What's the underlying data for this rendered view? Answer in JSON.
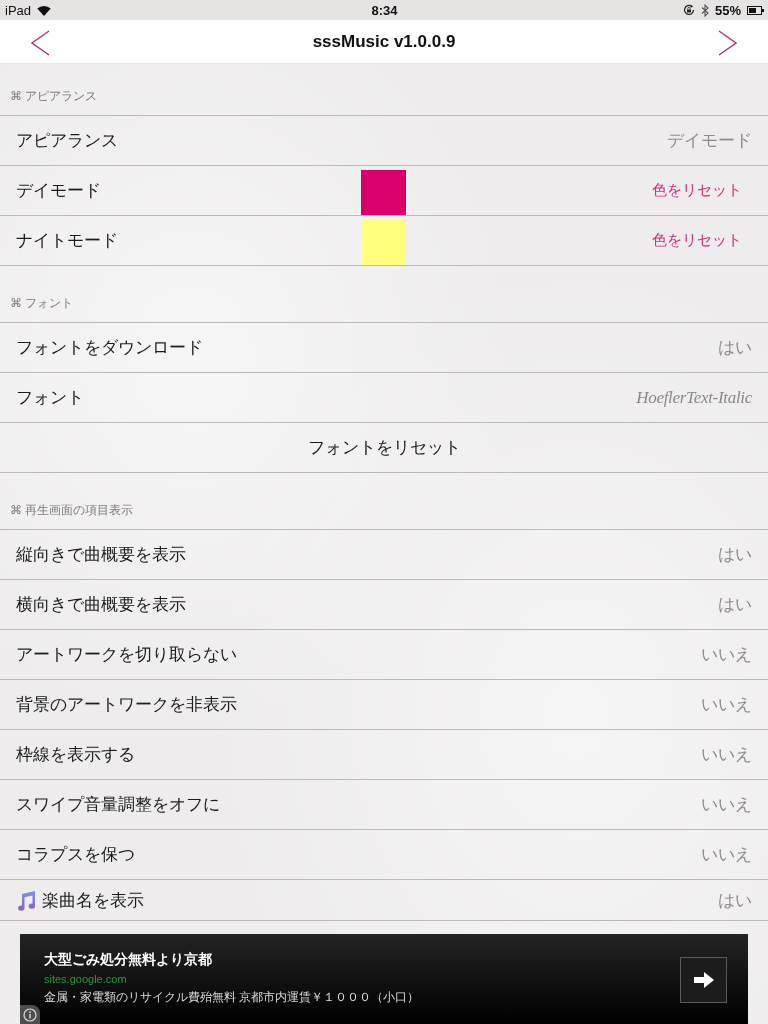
{
  "status_bar": {
    "carrier": "iPad",
    "time": "8:34",
    "battery": "55%"
  },
  "nav_bar": {
    "title": "sssMusic v1.0.0.9"
  },
  "sections": [
    {
      "header": "⌘ アピアランス",
      "rows": [
        {
          "kind": "value",
          "label": "アピアランス",
          "value": "デイモード"
        },
        {
          "kind": "swatch",
          "label": "デイモード",
          "color": "#d9006c",
          "action": "色をリセット"
        },
        {
          "kind": "swatch",
          "label": "ナイトモード",
          "color": "#ffff80",
          "action": "色をリセット"
        }
      ]
    },
    {
      "header": "⌘ フォント",
      "rows": [
        {
          "kind": "value",
          "label": "フォントをダウンロード",
          "value": "はい"
        },
        {
          "kind": "font",
          "label": "フォント",
          "value": "HoeflerText-Italic"
        },
        {
          "kind": "button",
          "label": "フォントをリセット"
        }
      ]
    },
    {
      "header": "⌘ 再生画面の項目表示",
      "rows": [
        {
          "kind": "value",
          "label": "縦向きで曲概要を表示",
          "value": "はい"
        },
        {
          "kind": "value",
          "label": "横向きで曲概要を表示",
          "value": "はい"
        },
        {
          "kind": "value",
          "label": "アートワークを切り取らない",
          "value": "いいえ"
        },
        {
          "kind": "value",
          "label": "背景のアートワークを非表示",
          "value": "いいえ"
        },
        {
          "kind": "value",
          "label": "枠線を表示する",
          "value": "いいえ"
        },
        {
          "kind": "value",
          "label": "スワイプ音量調整をオフに",
          "value": "いいえ"
        },
        {
          "kind": "value",
          "label": "コラプスを保つ",
          "value": "いいえ"
        },
        {
          "kind": "icon",
          "label": "楽曲名を表示",
          "value": "はい"
        }
      ]
    }
  ],
  "ad": {
    "title": "大型ごみ処分無料より京都",
    "url": "sites.google.com",
    "description": "金属・家電類のリサイクル費殆無料 京都市内運賃￥１０００（小口）"
  }
}
